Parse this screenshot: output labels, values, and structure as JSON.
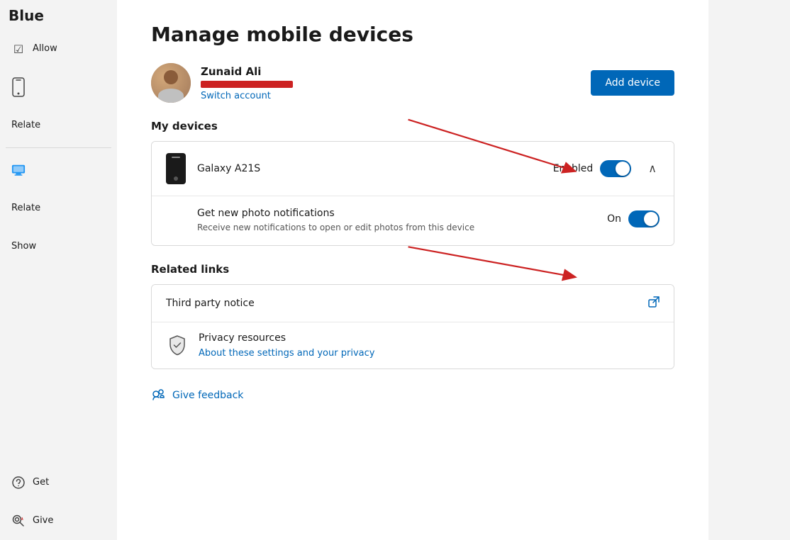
{
  "sidebar": {
    "header": "Blue",
    "items": [
      {
        "id": "allow",
        "label": "Allow",
        "icon": "☑",
        "active": false
      },
      {
        "id": "phone",
        "label": "",
        "icon": "📱",
        "active": false
      },
      {
        "id": "related1",
        "label": "Relate",
        "icon": "",
        "active": false
      },
      {
        "id": "remote",
        "label": "",
        "icon": "🖥",
        "active": false
      },
      {
        "id": "related2",
        "label": "Relate",
        "icon": "",
        "active": false
      },
      {
        "id": "show",
        "label": "Show",
        "icon": "",
        "active": false
      }
    ],
    "get_help": "Get",
    "give_feedback": "Give"
  },
  "main": {
    "title": "Manage mobile devices",
    "user": {
      "name": "Zunaid Ali",
      "switch_account": "Switch account",
      "add_device_btn": "Add device"
    },
    "my_devices_heading": "My devices",
    "device": {
      "name": "Galaxy A21S",
      "status_label": "Enabled",
      "toggle_on": true
    },
    "notification": {
      "title": "Get new photo notifications",
      "description": "Receive new notifications to open or edit photos from this device",
      "status_label": "On",
      "toggle_on": true
    },
    "related_links_heading": "Related links",
    "links": [
      {
        "id": "third-party",
        "text": "Third party notice",
        "has_external": true
      },
      {
        "id": "privacy",
        "title": "Privacy resources",
        "subtitle": "About these settings and your privacy",
        "has_icon": true
      }
    ],
    "feedback": {
      "label": "Give feedback"
    }
  },
  "colors": {
    "accent": "#0067b8",
    "toggle_active": "#0067b8",
    "arrow": "#cc2222"
  }
}
